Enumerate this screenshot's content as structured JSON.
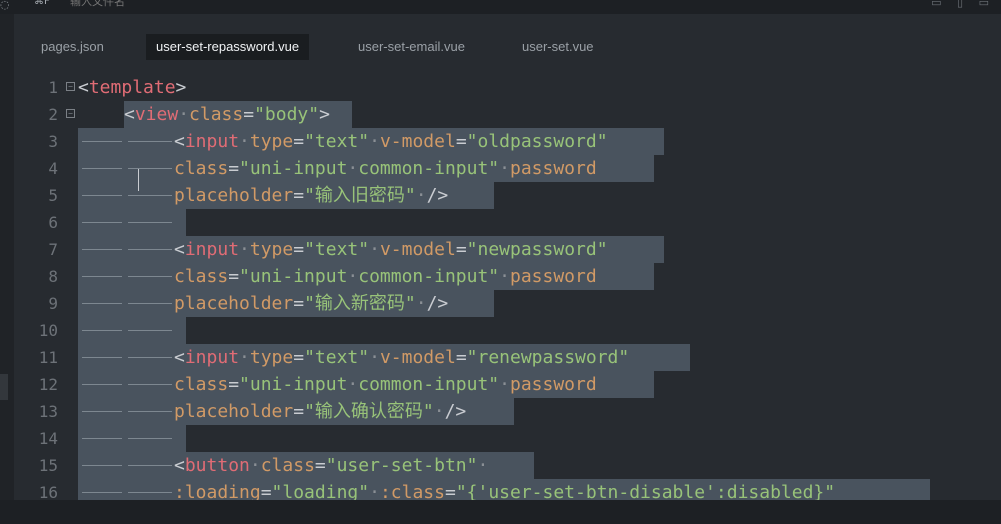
{
  "topbar": {
    "search_key": "⌘F",
    "search_placeholder": "输入文件名"
  },
  "tabs": [
    {
      "label": "pages.json",
      "active": false
    },
    {
      "label": "user-set-repassword.vue",
      "active": true
    },
    {
      "label": "user-set-email.vue",
      "active": false
    },
    {
      "label": "user-set.vue",
      "active": false
    }
  ],
  "editor": {
    "lines": [
      {
        "n": "1",
        "fold": true,
        "text": "<template>"
      },
      {
        "n": "2",
        "fold": true,
        "text": "<view class=\"body\">"
      },
      {
        "n": "3",
        "fold": false,
        "text": "<input type=\"text\" v-model=\"oldpassword\""
      },
      {
        "n": "4",
        "fold": false,
        "text": "class=\"uni-input common-input\" password"
      },
      {
        "n": "5",
        "fold": false,
        "text": "placeholder=\"输入旧密码\" />"
      },
      {
        "n": "6",
        "fold": false,
        "text": ""
      },
      {
        "n": "7",
        "fold": false,
        "text": "<input type=\"text\" v-model=\"newpassword\""
      },
      {
        "n": "8",
        "fold": false,
        "text": "class=\"uni-input common-input\" password"
      },
      {
        "n": "9",
        "fold": false,
        "text": "placeholder=\"输入新密码\" />"
      },
      {
        "n": "10",
        "fold": false,
        "text": ""
      },
      {
        "n": "11",
        "fold": false,
        "text": "<input type=\"text\" v-model=\"renewpassword\""
      },
      {
        "n": "12",
        "fold": false,
        "text": "class=\"uni-input common-input\" password"
      },
      {
        "n": "13",
        "fold": false,
        "text": "placeholder=\"输入确认密码\" />"
      },
      {
        "n": "14",
        "fold": false,
        "text": ""
      },
      {
        "n": "15",
        "fold": false,
        "text": "<button class=\"user-set-btn\""
      },
      {
        "n": "16",
        "fold": false,
        "text": ":loading=\"loading\" :class=\"{'user-set-btn-disable':disabled}\""
      }
    ]
  },
  "colors": {
    "background": "#272b30",
    "selection": "#49535e",
    "tag": "#e06c75",
    "attribute": "#d19a66",
    "string": "#98c379",
    "line_number": "#6d7278"
  }
}
